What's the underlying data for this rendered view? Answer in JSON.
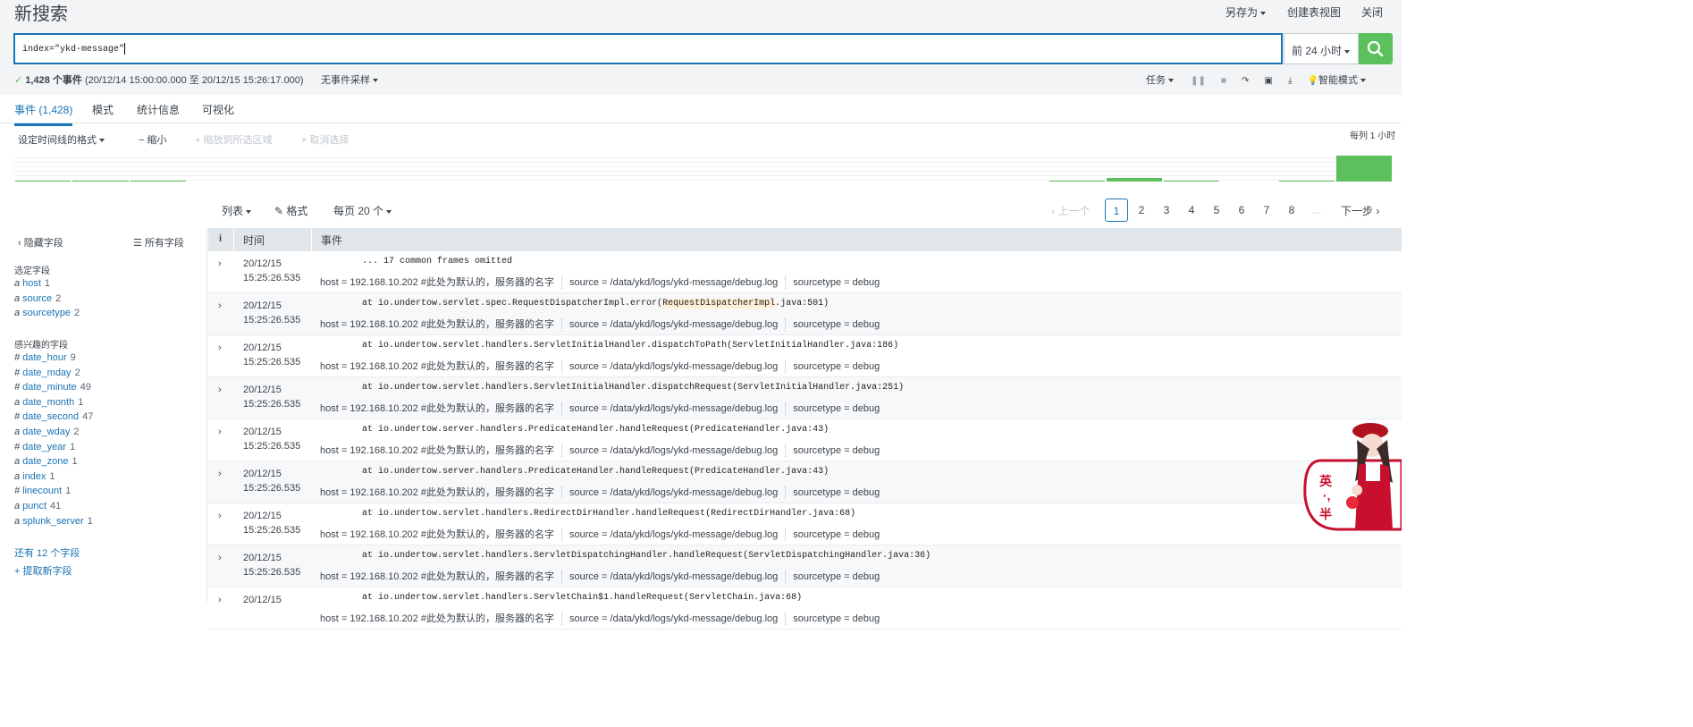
{
  "header": {
    "title": "新搜索",
    "save_as": "另存为",
    "create_dashboard": "创建表视图",
    "close": "关闭"
  },
  "search": {
    "query": "index=\"ykd-message\"",
    "time_range": "前 24 小时"
  },
  "status": {
    "check": "✓",
    "count": "1,428 个事件",
    "range": "(20/12/14 15:00:00.000 至 20/12/15 15:26:17.000)",
    "sampling": "无事件采样"
  },
  "jobbar": {
    "job": "任务",
    "mode": "智能模式"
  },
  "tabs": [
    {
      "label": "事件 (1,428)"
    },
    {
      "label": "模式"
    },
    {
      "label": "统计信息"
    },
    {
      "label": "可视化"
    }
  ],
  "timeline": {
    "format": "设定时间线的格式",
    "zoom_out": "− 缩小",
    "zoom_select": "+ 缩放到所选区域",
    "deselect": "× 取消选择",
    "scale": "每列 1 小时",
    "bar_levels": [
      0,
      0,
      0,
      0,
      0,
      0,
      0,
      0,
      0,
      0,
      0,
      0,
      0,
      0,
      0,
      0,
      0,
      0,
      0,
      0,
      0,
      0,
      0,
      0.1
    ]
  },
  "results_toolbar": {
    "list": "列表",
    "format": "格式",
    "per_page": "每页 20 个"
  },
  "pager": {
    "prev": "‹ 上一个",
    "pages": [
      "1",
      "2",
      "3",
      "4",
      "5",
      "6",
      "7",
      "8"
    ],
    "ellipsis": "...",
    "next": "下一步 ›"
  },
  "sidebar": {
    "hide_fields": "隐藏字段",
    "all_fields": "所有字段",
    "selected_header": "选定字段",
    "selected": [
      {
        "type": "a",
        "name": "host",
        "count": "1"
      },
      {
        "type": "a",
        "name": "source",
        "count": "2"
      },
      {
        "type": "a",
        "name": "sourcetype",
        "count": "2"
      }
    ],
    "interesting_header": "感兴趣的字段",
    "interesting": [
      {
        "type": "#",
        "name": "date_hour",
        "count": "9"
      },
      {
        "type": "#",
        "name": "date_mday",
        "count": "2"
      },
      {
        "type": "#",
        "name": "date_minute",
        "count": "49"
      },
      {
        "type": "a",
        "name": "date_month",
        "count": "1"
      },
      {
        "type": "#",
        "name": "date_second",
        "count": "47"
      },
      {
        "type": "a",
        "name": "date_wday",
        "count": "2"
      },
      {
        "type": "#",
        "name": "date_year",
        "count": "1"
      },
      {
        "type": "a",
        "name": "date_zone",
        "count": "1"
      },
      {
        "type": "a",
        "name": "index",
        "count": "1"
      },
      {
        "type": "#",
        "name": "linecount",
        "count": "1"
      },
      {
        "type": "a",
        "name": "punct",
        "count": "41"
      },
      {
        "type": "a",
        "name": "splunk_server",
        "count": "1"
      }
    ],
    "more_fields": "还有 12 个字段",
    "extract": "+ 提取新字段"
  },
  "table": {
    "col_i": "i",
    "col_time": "时间",
    "col_event": "事件"
  },
  "meta": {
    "host": "host = 192.168.10.202 #此处为默认的，服务器的名字",
    "source": "source = /data/ykd/logs/ykd-message/debug.log",
    "sourcetype": "sourcetype = debug"
  },
  "events": [
    {
      "date": "20/12/15",
      "time": "15:25:26.535",
      "msg": "... 17 common frames omitted"
    },
    {
      "date": "20/12/15",
      "time": "15:25:26.535",
      "msg_pre": "at io.undertow.servlet.spec.RequestDispatcherImpl.error(",
      "msg_hl": "RequestDispatcherImpl",
      "msg_post": ".java:501)"
    },
    {
      "date": "20/12/15",
      "time": "15:25:26.535",
      "msg": "at io.undertow.servlet.handlers.ServletInitialHandler.dispatchToPath(ServletInitialHandler.java:186)"
    },
    {
      "date": "20/12/15",
      "time": "15:25:26.535",
      "msg": "at io.undertow.servlet.handlers.ServletInitialHandler.dispatchRequest(ServletInitialHandler.java:251)"
    },
    {
      "date": "20/12/15",
      "time": "15:25:26.535",
      "msg": "at io.undertow.server.handlers.PredicateHandler.handleRequest(PredicateHandler.java:43)"
    },
    {
      "date": "20/12/15",
      "time": "15:25:26.535",
      "msg": "at io.undertow.server.handlers.PredicateHandler.handleRequest(PredicateHandler.java:43)"
    },
    {
      "date": "20/12/15",
      "time": "15:25:26.535",
      "msg": "at io.undertow.servlet.handlers.RedirectDirHandler.handleRequest(RedirectDirHandler.java:68)"
    },
    {
      "date": "20/12/15",
      "time": "15:25:26.535",
      "msg": "at io.undertow.servlet.handlers.ServletDispatchingHandler.handleRequest(ServletDispatchingHandler.java:36)"
    },
    {
      "date": "20/12/15",
      "time": "",
      "msg": "at io.undertow.servlet.handlers.ServletChain$1.handleRequest(ServletChain.java:68)"
    }
  ],
  "badge": {
    "text_top": "英",
    "text_mid": "·,",
    "text_bot": "半"
  },
  "colors": {
    "accent": "#1a73b5",
    "go": "#5cc05c",
    "timeline_bar": "#5cc05c",
    "mascot_red": "#c8102e"
  }
}
